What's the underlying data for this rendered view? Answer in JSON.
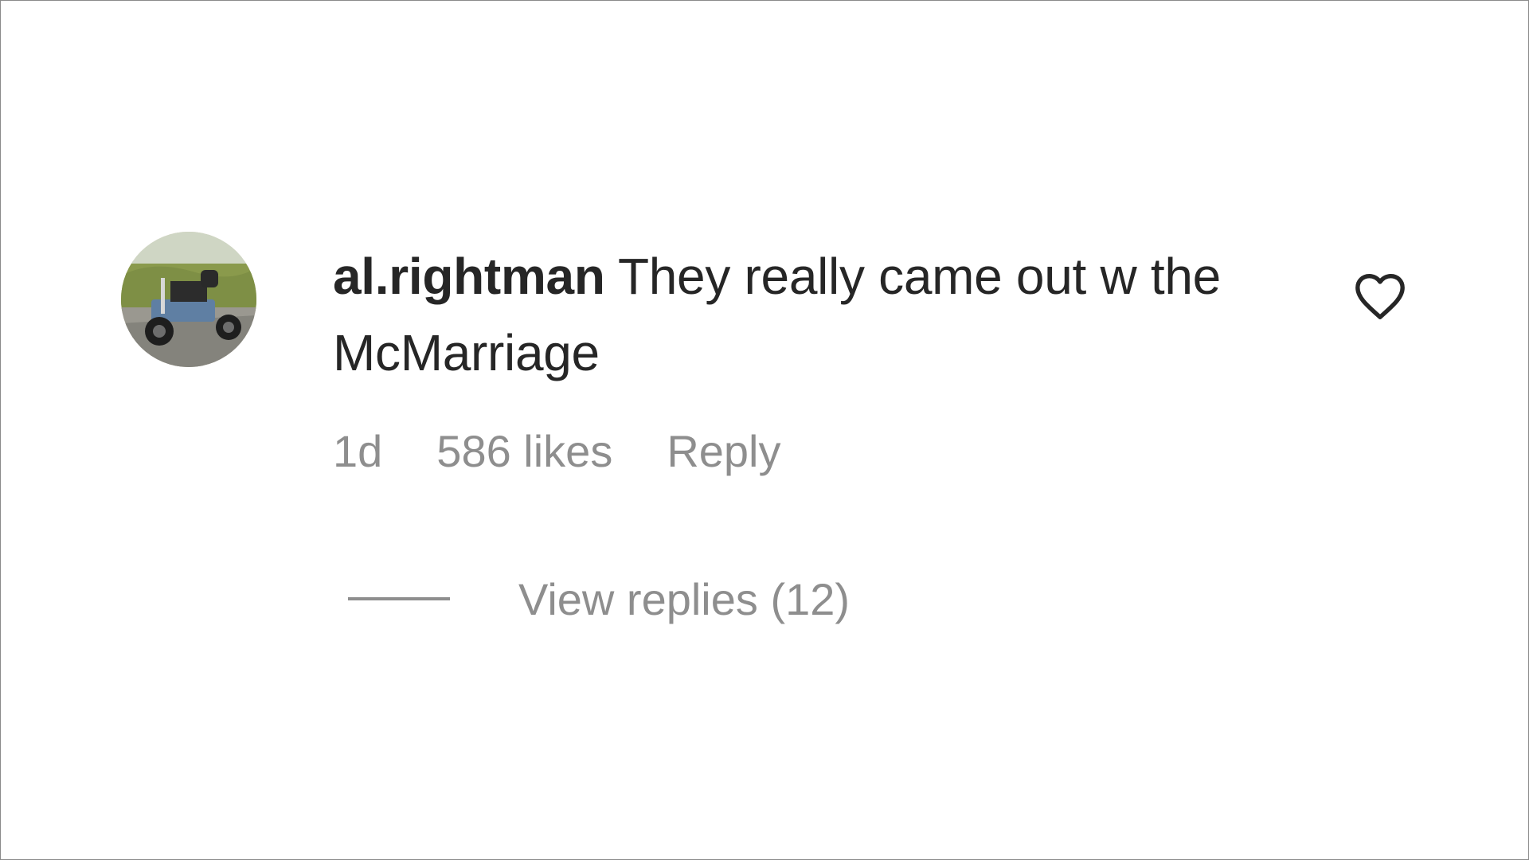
{
  "comment": {
    "username": "al.rightman",
    "text": "They really came out w the McMarriage",
    "time_ago": "1d",
    "likes": "586 likes",
    "reply_label": "Reply",
    "view_replies_label": "View replies (12)"
  },
  "icons": {
    "like": "heart-outline-icon",
    "avatar": "user-avatar-photo"
  },
  "colors": {
    "primary_text": "#262626",
    "secondary_text": "#8e8e8e",
    "background": "#ffffff"
  }
}
